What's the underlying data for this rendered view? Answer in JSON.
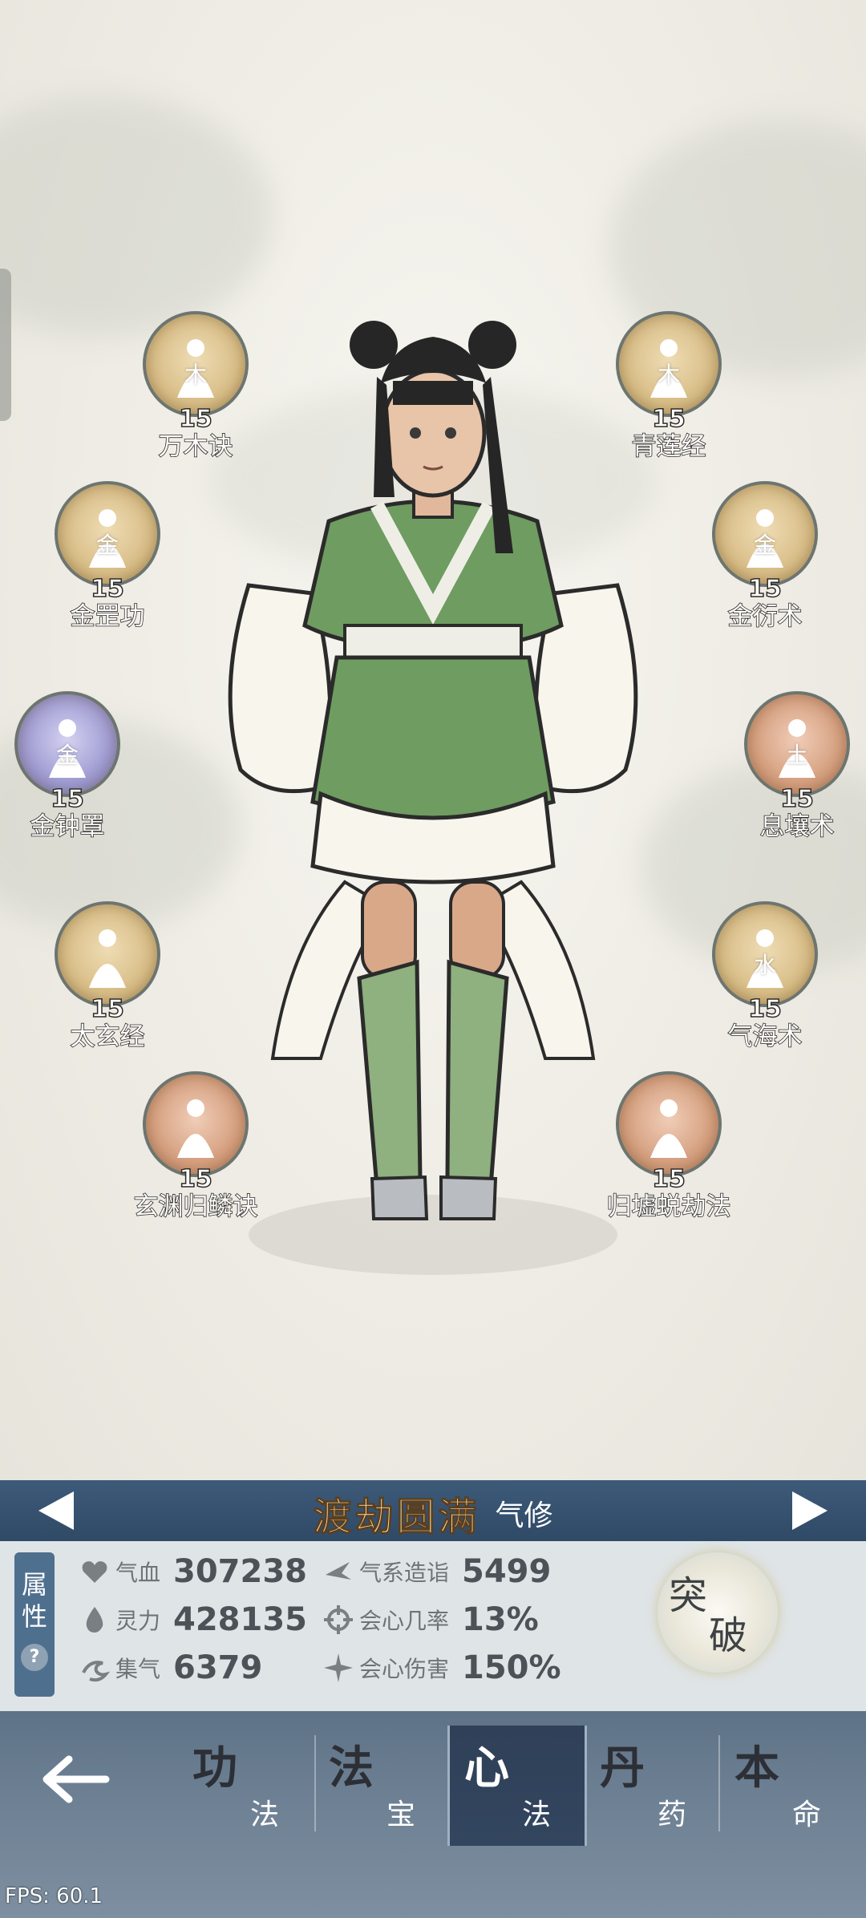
{
  "skills": [
    {
      "name": "万木诀",
      "level": "15",
      "element": "木",
      "color": "gold"
    },
    {
      "name": "青莲经",
      "level": "15",
      "element": "木",
      "color": "gold"
    },
    {
      "name": "金罡功",
      "level": "15",
      "element": "金",
      "color": "gold"
    },
    {
      "name": "金衍术",
      "level": "15",
      "element": "金",
      "color": "gold"
    },
    {
      "name": "金钟罩",
      "level": "15",
      "element": "金",
      "color": "purple"
    },
    {
      "name": "息壤术",
      "level": "15",
      "element": "土",
      "color": "copper"
    },
    {
      "name": "太玄经",
      "level": "15",
      "element": "",
      "color": "gold"
    },
    {
      "name": "气海术",
      "level": "15",
      "element": "水",
      "color": "gold"
    },
    {
      "name": "玄渊归鳞诀",
      "level": "15",
      "element": "",
      "color": "copper"
    },
    {
      "name": "归墟蜕劫法",
      "level": "15",
      "element": "",
      "color": "copper"
    }
  ],
  "realm": {
    "title": "渡劫圆满",
    "type": "气修"
  },
  "attributes": {
    "tag_line1": "属",
    "tag_line2": "性",
    "help": "?",
    "qixue": {
      "label": "气血",
      "value": "307238"
    },
    "lingli": {
      "label": "灵力",
      "value": "428135"
    },
    "jiqi": {
      "label": "集气",
      "value": "6379"
    },
    "qixi": {
      "label": "气系造诣",
      "value": "5499"
    },
    "huixin_rate": {
      "label": "会心几率",
      "value": "13%"
    },
    "huixin_dmg": {
      "label": "会心伤害",
      "value": "150%"
    }
  },
  "breakthrough": {
    "char1": "突",
    "char2": "破"
  },
  "nav": {
    "tabs": [
      {
        "c1": "功",
        "c2": "法"
      },
      {
        "c1": "法",
        "c2": "宝"
      },
      {
        "c1": "心",
        "c2": "法"
      },
      {
        "c1": "丹",
        "c2": "药"
      },
      {
        "c1": "本",
        "c2": "命"
      }
    ],
    "active_index": 2
  },
  "fps": "FPS: 60.1",
  "colors": {
    "realm_bar": "#2f4a66",
    "nav": "#6d8093",
    "active_tab": "#2f4058",
    "attr_tag": "#4f6f8e"
  }
}
